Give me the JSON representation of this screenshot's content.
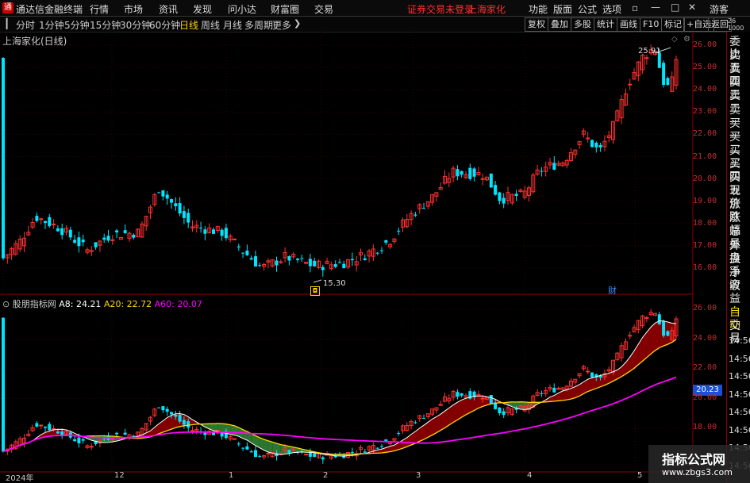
{
  "titlebar": {
    "app_title": "通达信金融终端",
    "menus": [
      "行情",
      "市场",
      "资讯",
      "发现",
      "问小达",
      "财富圈",
      "交易"
    ],
    "status": "证券交易未登录",
    "stock_name": "上海家化",
    "right_menus": [
      "功能",
      "版面",
      "公式",
      "选项"
    ],
    "guest": "游客"
  },
  "toolbar": {
    "periods": [
      "分时",
      "1分钟",
      "5分钟",
      "15分钟",
      "30分钟",
      "60分钟",
      "日线",
      "周线",
      "月线",
      "多周期",
      "更多"
    ],
    "active_period": "日线",
    "buttons": [
      "复权",
      "叠加",
      "多股",
      "统计",
      "画线",
      "F10",
      "标记",
      "+自选",
      "返回"
    ]
  },
  "main_chart": {
    "label": "上海家化(日线)",
    "high_label": "25.91",
    "low_label": "15.30",
    "fin_marker": "财"
  },
  "indicator": {
    "name": "股朋指标网",
    "a8_label": "A8: 24.21",
    "a20_label": "A20: 22.72",
    "a60_label": "A60: 20.07",
    "current_value": "20.23"
  },
  "side_panel": {
    "labels_top": [
      "委比",
      "卖五",
      "卖四",
      "卖三",
      "卖二",
      "卖一",
      "买一",
      "买二",
      "买三",
      "买四",
      "买五",
      "现价",
      "涨跌",
      "涨幅",
      "总量",
      "外盘",
      "换手",
      "净资",
      "收益"
    ],
    "labels_bottom": [
      "自动",
      "交易"
    ],
    "times": [
      "14:56",
      "14:56",
      "14:56",
      "14:56",
      "14:56",
      "14:56",
      "14:56",
      "14:56"
    ],
    "small_top": "26",
    "small_top2": "1000"
  },
  "axis_main": [
    "26.00",
    "25.00",
    "24.00",
    "23.00",
    "22.00",
    "21.00",
    "20.00",
    "19.00",
    "18.00",
    "17.00",
    "16.00"
  ],
  "axis_ind": [
    "26.00",
    "24.00",
    "22.00",
    "20.00",
    "18.00"
  ],
  "x_labels": [
    "2024年",
    "12",
    "1",
    "2",
    "3",
    "4",
    "5"
  ],
  "watermark": {
    "line1": "指标公式网",
    "line2": "www.zbgs3.com"
  },
  "colors": {
    "up": "#ff3030",
    "down": "#00e5ff",
    "a8": "#ffffff",
    "a20": "#ffd700",
    "a60": "#ff00ff"
  }
}
